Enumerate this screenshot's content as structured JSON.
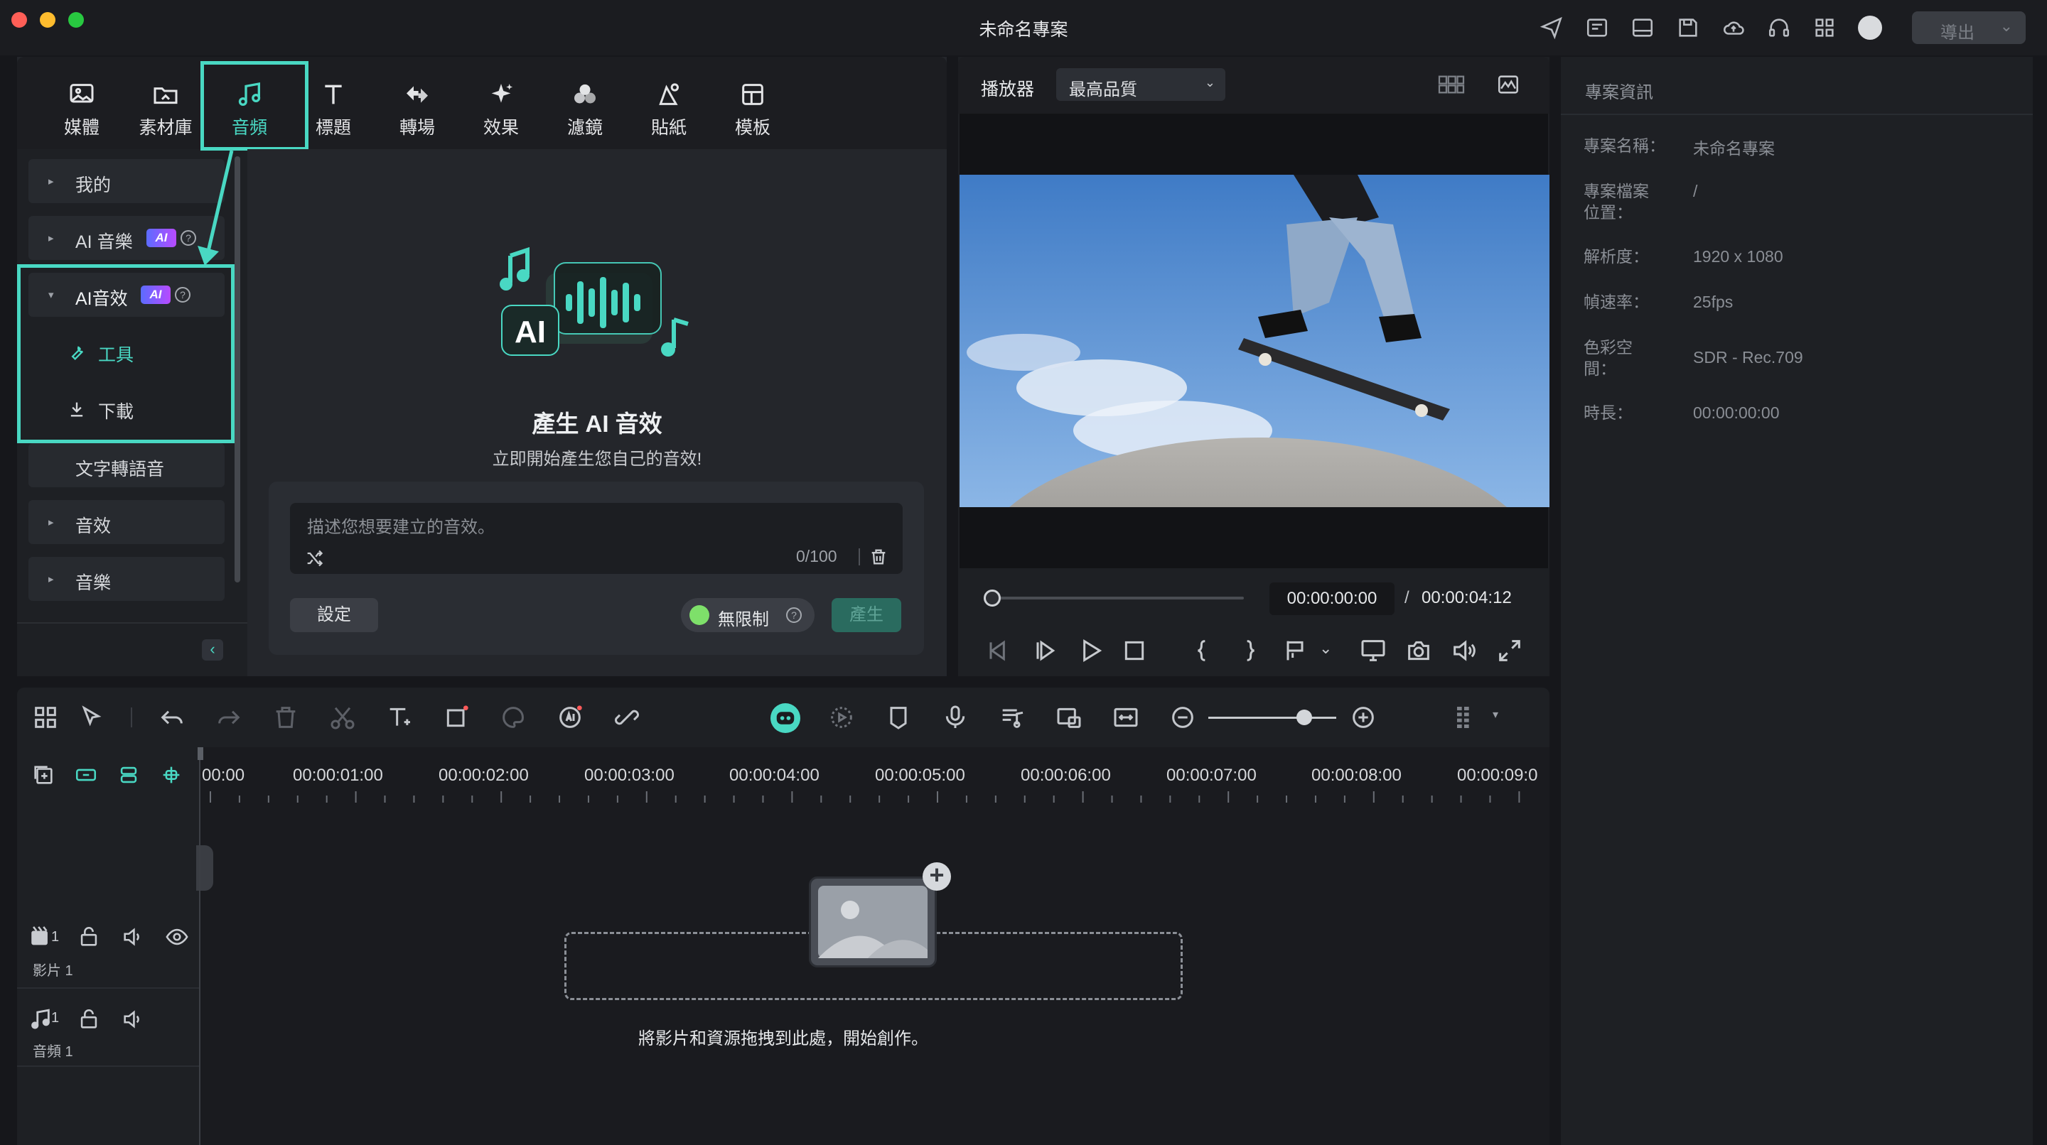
{
  "app": {
    "title": "未命名專案",
    "export_label": "導出"
  },
  "media_tabs": [
    {
      "id": "media",
      "label": "媒體"
    },
    {
      "id": "library",
      "label": "素材庫"
    },
    {
      "id": "audio",
      "label": "音頻"
    },
    {
      "id": "titles",
      "label": "標題"
    },
    {
      "id": "transitions",
      "label": "轉場"
    },
    {
      "id": "effects",
      "label": "效果"
    },
    {
      "id": "filters",
      "label": "濾鏡"
    },
    {
      "id": "stickers",
      "label": "貼紙"
    },
    {
      "id": "templates",
      "label": "模板"
    }
  ],
  "sidebar": {
    "items": [
      {
        "label": "我的",
        "expanded": false
      },
      {
        "label": "AI 音樂",
        "badge": "AI",
        "expanded": false
      },
      {
        "label": "AI音效",
        "badge": "AI",
        "expanded": true
      },
      {
        "label": "文字轉語音"
      },
      {
        "label": "音效",
        "expanded": false
      },
      {
        "label": "音樂",
        "expanded": false
      }
    ],
    "sub_items": [
      {
        "label": "工具",
        "icon": "wrench-icon",
        "active": true
      },
      {
        "label": "下載",
        "icon": "download-icon",
        "active": false
      }
    ]
  },
  "ai_sfx": {
    "title": "產生 AI 音效",
    "subtitle": "立即開始產生您自己的音效!",
    "logo_text": "AI",
    "placeholder": "描述您想要建立的音效。",
    "char_count": "0/100",
    "settings_label": "設定",
    "unlimited_label": "無限制",
    "generate_label": "產生"
  },
  "player": {
    "label": "播放器",
    "quality": "最高品質",
    "current_time": "00:00:00:00",
    "separator": "/",
    "total_time": "00:00:04:12",
    "progress": 0
  },
  "project_info": {
    "header": "專案資訊",
    "rows": [
      {
        "key": "專案名稱：",
        "value": "未命名專案"
      },
      {
        "key": "專案檔案位置：",
        "value": "/"
      },
      {
        "key": "解析度：",
        "value": "1920 x 1080"
      },
      {
        "key": "幀速率：",
        "value": "25fps"
      },
      {
        "key": "色彩空間：",
        "value": "SDR - Rec.709"
      },
      {
        "key": "時長：",
        "value": "00:00:00:00"
      }
    ]
  },
  "timeline": {
    "ruler": [
      "00:00",
      "00:00:01:00",
      "00:00:02:00",
      "00:00:03:00",
      "00:00:04:00",
      "00:00:05:00",
      "00:00:06:00",
      "00:00:07:00",
      "00:00:08:00",
      "00:00:09:0"
    ],
    "tracks": [
      {
        "label": "影片 1",
        "number": "1"
      },
      {
        "label": "音頻 1",
        "number": "1"
      }
    ],
    "drop_hint": "將影片和資源拖拽到此處，開始創作。"
  },
  "colors": {
    "accent": "#49d8c3",
    "background": "#16171b",
    "panel": "#1e2024"
  }
}
